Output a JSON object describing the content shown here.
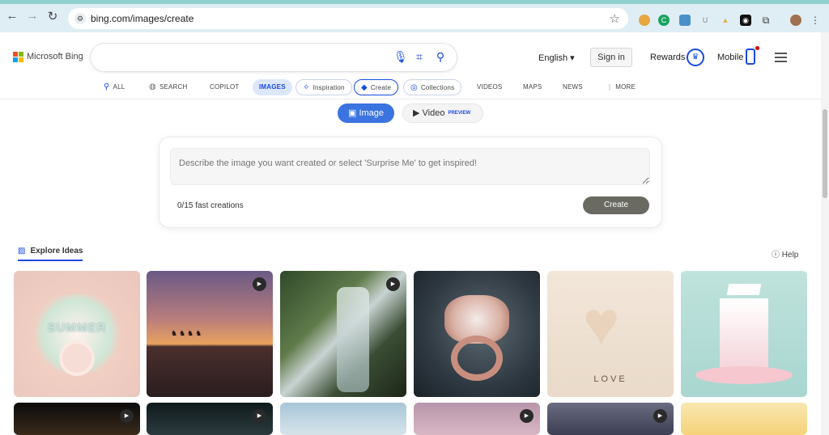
{
  "browser": {
    "url": "bing.com/images/create"
  },
  "header": {
    "brand": "Microsoft Bing",
    "language": "English",
    "sign_in": "Sign in",
    "rewards": "Rewards",
    "mobile": "Mobile"
  },
  "tabs": [
    {
      "label": "ALL"
    },
    {
      "label": "SEARCH"
    },
    {
      "label": "COPILOT"
    },
    {
      "label": "IMAGES"
    },
    {
      "label": "Inspiration"
    },
    {
      "label": "Create"
    },
    {
      "label": "Collections"
    },
    {
      "label": "VIDEOS"
    },
    {
      "label": "MAPS"
    },
    {
      "label": "NEWS"
    },
    {
      "label": "MORE"
    }
  ],
  "mode": {
    "image": "Image",
    "video": "Video",
    "video_badge": "PREVIEW"
  },
  "create_panel": {
    "placeholder": "Describe the image you want created or select 'Surprise Me' to get inspired!",
    "fast_creations": "0/15 fast creations",
    "create_button": "Create"
  },
  "explore": {
    "title": "Explore Ideas",
    "help": "Help",
    "tile_text_love": "LOVE",
    "tile_text_summer": "SUMMER"
  },
  "colors": {
    "accent": "#174ae4",
    "image_button": "#3b73e0",
    "create_button": "#6a6a63"
  }
}
